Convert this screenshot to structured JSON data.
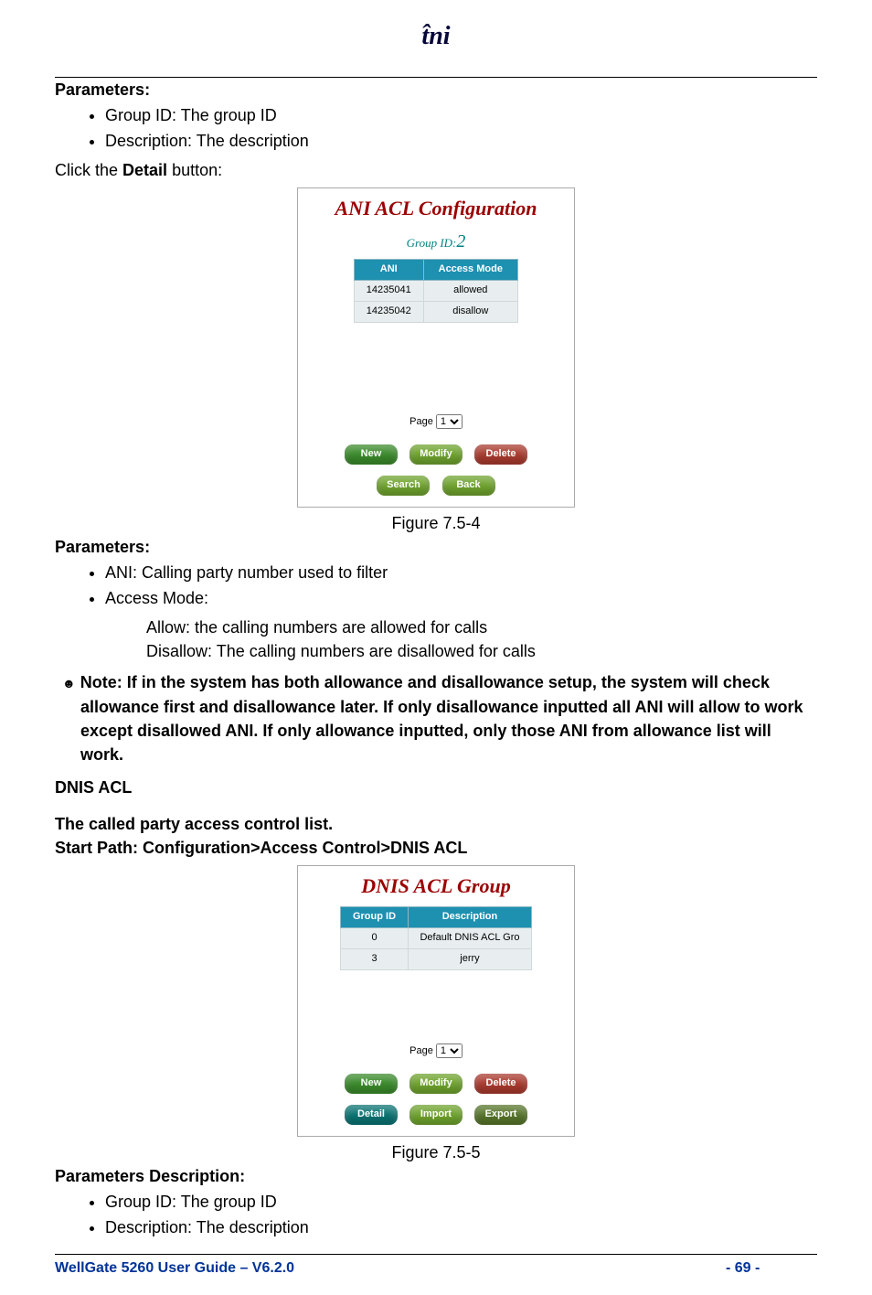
{
  "header": {
    "logo_text": "t̂ni"
  },
  "params_heading": "Parameters:",
  "params1": [
    "Group ID: The group ID",
    "Description: The description"
  ],
  "click_detail": {
    "pre": "Click the ",
    "bold": "Detail",
    "post": " button:"
  },
  "fig1": {
    "title": "ANI ACL Configuration",
    "group_label": "Group ID:",
    "group_value": "2",
    "headers": [
      "ANI",
      "Access Mode"
    ],
    "rows": [
      [
        "14235041",
        "allowed"
      ],
      [
        "14235042",
        "disallow"
      ]
    ],
    "page_label": "Page ",
    "page_opt": "1",
    "buttons_row1": [
      "New",
      "Modify",
      "Delete"
    ],
    "buttons_row2": [
      "Search",
      "Back"
    ],
    "caption": "Figure 7.5-4"
  },
  "params2_heading": "Parameters:",
  "params2": [
    "ANI: Calling party number used to filter",
    "Access Mode:"
  ],
  "sub_allow": "Allow: the calling numbers are allowed for calls",
  "sub_disallow": "Disallow: The calling numbers are disallowed for calls",
  "note": {
    "symbol": "☻",
    "label": "Note: ",
    "text": "If in the system has both allowance and disallowance setup, the system will check allowance first and disallowance later. If only disallowance inputted all ANI will allow to work except disallowed ANI. If only allowance inputted, only those ANI from allowance list will work."
  },
  "dnis_heading": "DNIS ACL",
  "dnis_intro": "The called party access control list.",
  "dnis_path": "Start Path: Configuration>Access Control>DNIS ACL",
  "fig2": {
    "title": "DNIS ACL Group",
    "headers": [
      "Group ID",
      "Description"
    ],
    "rows": [
      [
        "0",
        "Default DNIS ACL Gro"
      ],
      [
        "3",
        "jerry"
      ]
    ],
    "page_label": "Page ",
    "page_opt": "1",
    "buttons_row1": [
      "New",
      "Modify",
      "Delete"
    ],
    "buttons_row2": [
      "Detail",
      "Import",
      "Export"
    ],
    "caption": "Figure 7.5-5"
  },
  "params3_heading": "Parameters Description:",
  "params3": [
    "Group ID: The group ID",
    "Description: The description"
  ],
  "footer": {
    "left": "WellGate 5260 User Guide – V6.2.0",
    "right": "- 69 -"
  }
}
